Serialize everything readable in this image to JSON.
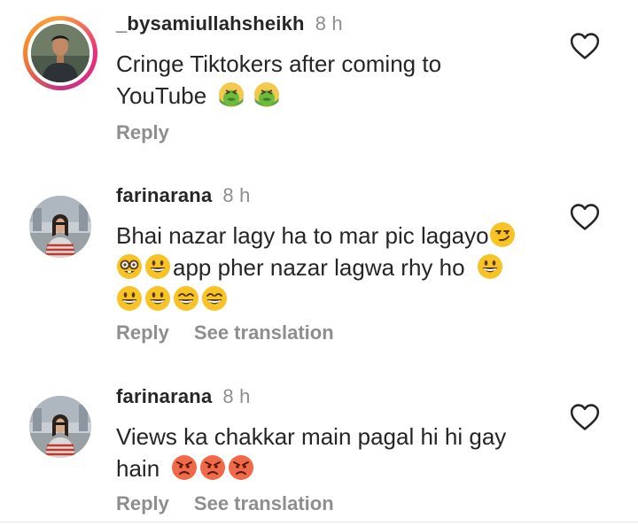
{
  "comments": [
    {
      "username": "_bysamiullahsheikh",
      "time": "8 h",
      "text_line1": "Cringe Tiktokers after coming to",
      "text_line2": "YouTube",
      "emojis_line2": [
        "nauseated-face-icon",
        "nauseated-face-icon"
      ],
      "reply_label": "Reply",
      "has_story_ring": true
    },
    {
      "username": "farinarana",
      "time": "8 h",
      "text_line1": "Bhai nazar lagy ha to mar pic lagayo",
      "text_line2": "app pher nazar lagwa rhy ho",
      "emojis": {
        "line1_end": [
          "smirking-face-icon"
        ],
        "line2_start": [
          "nerd-face-icon",
          "grinning-face-icon"
        ],
        "line2_end": [
          "grinning-face-icon"
        ],
        "line3": [
          "grinning-face-icon",
          "grinning-face-icon",
          "smiling-eyes-face-icon",
          "smiling-eyes-face-icon"
        ]
      },
      "reply_label": "Reply",
      "translate_label": "See translation"
    },
    {
      "username": "farinarana",
      "time": "8 h",
      "text_line1": "Views ka chakkar main pagal hi hi gay",
      "text_line2": "hain",
      "emojis_line2": [
        "angry-face-icon",
        "angry-face-icon",
        "angry-face-icon"
      ],
      "reply_label": "Reply",
      "translate_label": "See translation"
    }
  ],
  "colors": {
    "text": "#262626",
    "secondary": "#8e8e8e",
    "story_ring_start": "#f9a13a",
    "story_ring_end": "#ee2a7b"
  }
}
